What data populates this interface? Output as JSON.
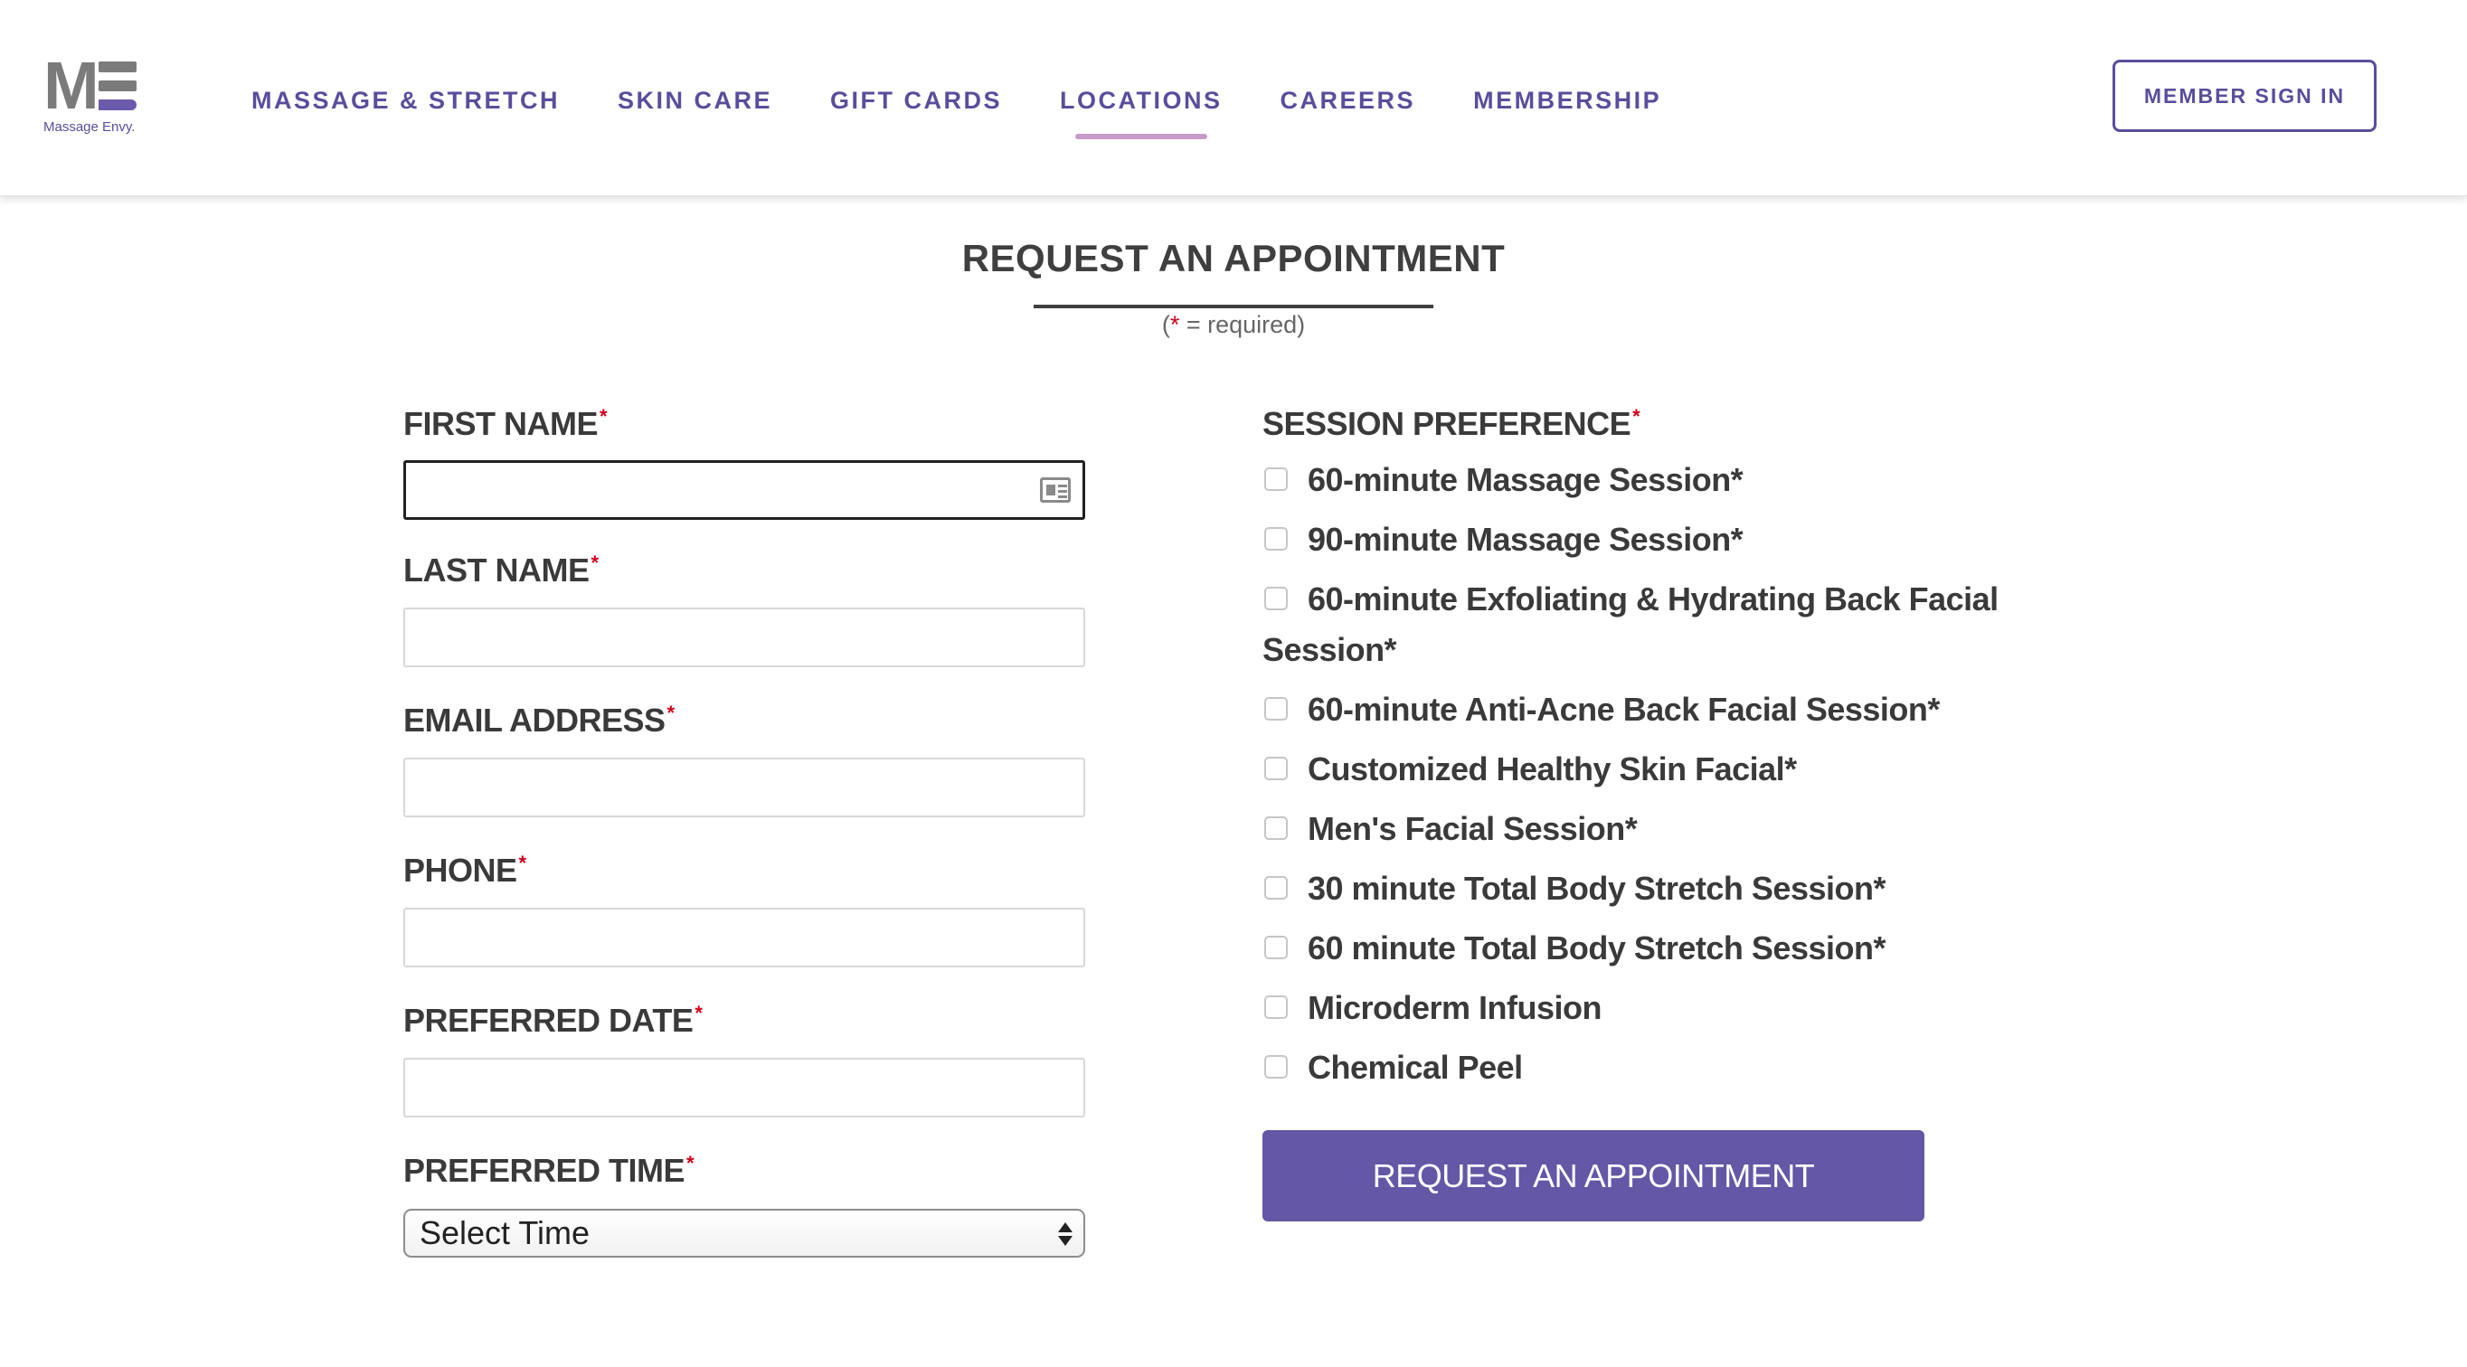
{
  "brand": {
    "logo_text": "Massage Envy.",
    "monogram": "M"
  },
  "nav": {
    "items": [
      {
        "label": "MASSAGE & STRETCH",
        "active": false
      },
      {
        "label": "SKIN CARE",
        "active": false
      },
      {
        "label": "GIFT CARDS",
        "active": false
      },
      {
        "label": "LOCATIONS",
        "active": true
      },
      {
        "label": "CAREERS",
        "active": false
      },
      {
        "label": "MEMBERSHIP",
        "active": false
      }
    ],
    "sign_in_label": "MEMBER SIGN IN"
  },
  "page": {
    "title": "REQUEST AN APPOINTMENT",
    "required_note": {
      "open": "(",
      "star": "*",
      "rest": " = required)"
    }
  },
  "form": {
    "required_mark": "*",
    "fields": {
      "first_name": {
        "label": "FIRST NAME",
        "value": ""
      },
      "last_name": {
        "label": "LAST NAME",
        "value": ""
      },
      "email": {
        "label": "EMAIL ADDRESS",
        "value": ""
      },
      "phone": {
        "label": "PHONE",
        "value": ""
      },
      "preferred_date": {
        "label": "PREFERRED DATE",
        "value": ""
      },
      "preferred_time": {
        "label": "PREFERRED TIME",
        "selected": "Select Time"
      }
    },
    "session_preference": {
      "label": "SESSION PREFERENCE",
      "options": [
        {
          "label": "60-minute Massage Session*",
          "checked": false
        },
        {
          "label": "90-minute Massage Session*",
          "checked": false
        },
        {
          "label": "60-minute Exfoliating & Hydrating Back Facial Session*",
          "checked": false
        },
        {
          "label": "60-minute Anti-Acne Back Facial Session*",
          "checked": false
        },
        {
          "label": "Customized Healthy Skin Facial*",
          "checked": false
        },
        {
          "label": "Men's Facial Session*",
          "checked": false
        },
        {
          "label": "30 minute Total Body Stretch Session*",
          "checked": false
        },
        {
          "label": "60 minute Total Body Stretch Session*",
          "checked": false
        },
        {
          "label": "Microderm Infusion",
          "checked": false
        },
        {
          "label": "Chemical Peel",
          "checked": false
        }
      ]
    },
    "submit_label": "REQUEST AN APPOINTMENT"
  },
  "colors": {
    "brand_purple": "#5b4d9c",
    "button_purple": "#6357a6",
    "nav_underline": "#c89ac9",
    "required_red": "#d0021b"
  }
}
